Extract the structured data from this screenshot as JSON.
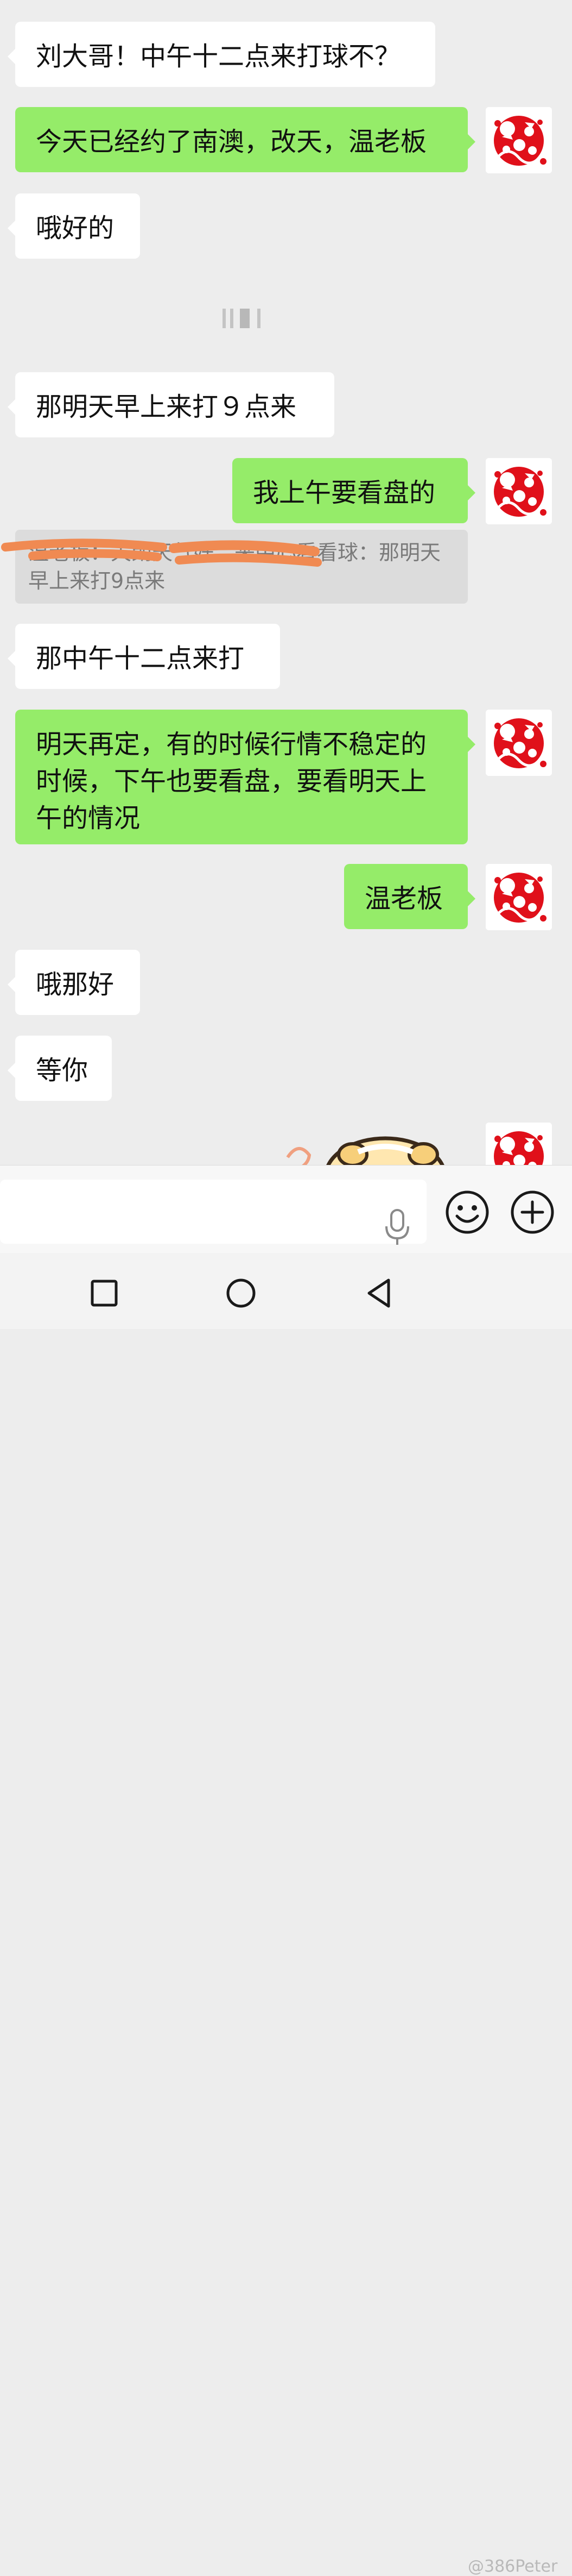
{
  "messages": [
    {
      "text": "刘大哥！中午十二点来打球不？"
    },
    {
      "text": "今天已经约了南澳，改天，温老板"
    },
    {
      "text": "哦好的"
    },
    {
      "text": "那明天早上来打９点来"
    },
    {
      "text": "我上午要看盘的"
    },
    {
      "text": "那中午十二点来打"
    },
    {
      "text": "明天再定，有的时候行情不稳定的时候，下午也要看盘，要看明天上午的情况"
    },
    {
      "text": "温老板"
    },
    {
      "text": "哦那好"
    },
    {
      "text": "等你"
    }
  ],
  "quote": {
    "text": "温老板：天朗天气好，来中心看看球：那明天早上来打9点来"
  },
  "input": {
    "placeholder": ""
  },
  "icons": {
    "mic": "microphone-icon",
    "emoji": "emoji-icon",
    "more": "plus-icon",
    "nav_recent": "square-icon",
    "nav_home": "circle-icon",
    "nav_back": "triangle-back-icon"
  },
  "colors": {
    "background": "#ededed",
    "incoming": "#ffffff",
    "outgoing": "#95ec69",
    "avatar_red": "#e0101a"
  },
  "watermark": "@386Peter"
}
